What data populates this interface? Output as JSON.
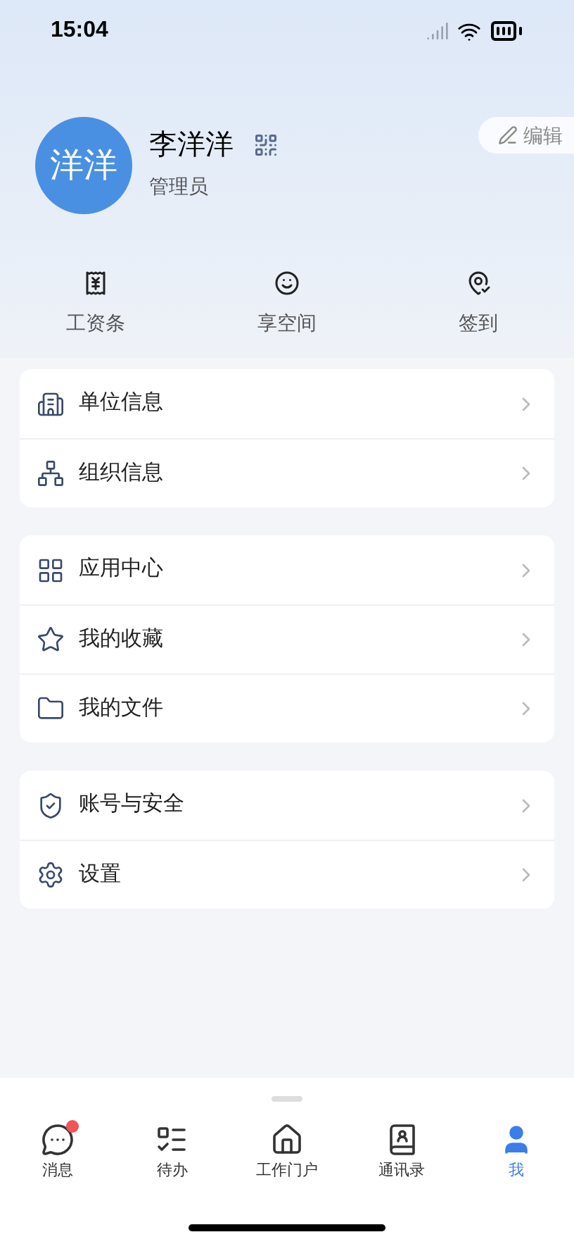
{
  "status_bar": {
    "time": "15:04"
  },
  "profile": {
    "avatar_text": "洋洋",
    "name": "李洋洋",
    "role": "管理员",
    "edit_label": "编辑"
  },
  "quick_actions": [
    {
      "kind": "payslip",
      "label": "工资条"
    },
    {
      "kind": "space",
      "label": "享空间"
    },
    {
      "kind": "checkin",
      "label": "签到"
    }
  ],
  "menu_groups": [
    [
      {
        "kind": "building",
        "label": "单位信息"
      },
      {
        "kind": "org",
        "label": "组织信息"
      }
    ],
    [
      {
        "kind": "apps",
        "label": "应用中心"
      },
      {
        "kind": "star",
        "label": "我的收藏"
      },
      {
        "kind": "folder",
        "label": "我的文件"
      }
    ],
    [
      {
        "kind": "shield",
        "label": "账号与安全"
      },
      {
        "kind": "settings",
        "label": "设置"
      }
    ]
  ],
  "tab_bar": [
    {
      "kind": "message",
      "label": "消息",
      "selected": false,
      "badge": true
    },
    {
      "kind": "todo",
      "label": "待办",
      "selected": false,
      "badge": false
    },
    {
      "kind": "home",
      "label": "工作门户",
      "selected": false,
      "badge": false
    },
    {
      "kind": "contacts",
      "label": "通讯录",
      "selected": false,
      "badge": false
    },
    {
      "kind": "me",
      "label": "我",
      "selected": true,
      "badge": false
    }
  ]
}
